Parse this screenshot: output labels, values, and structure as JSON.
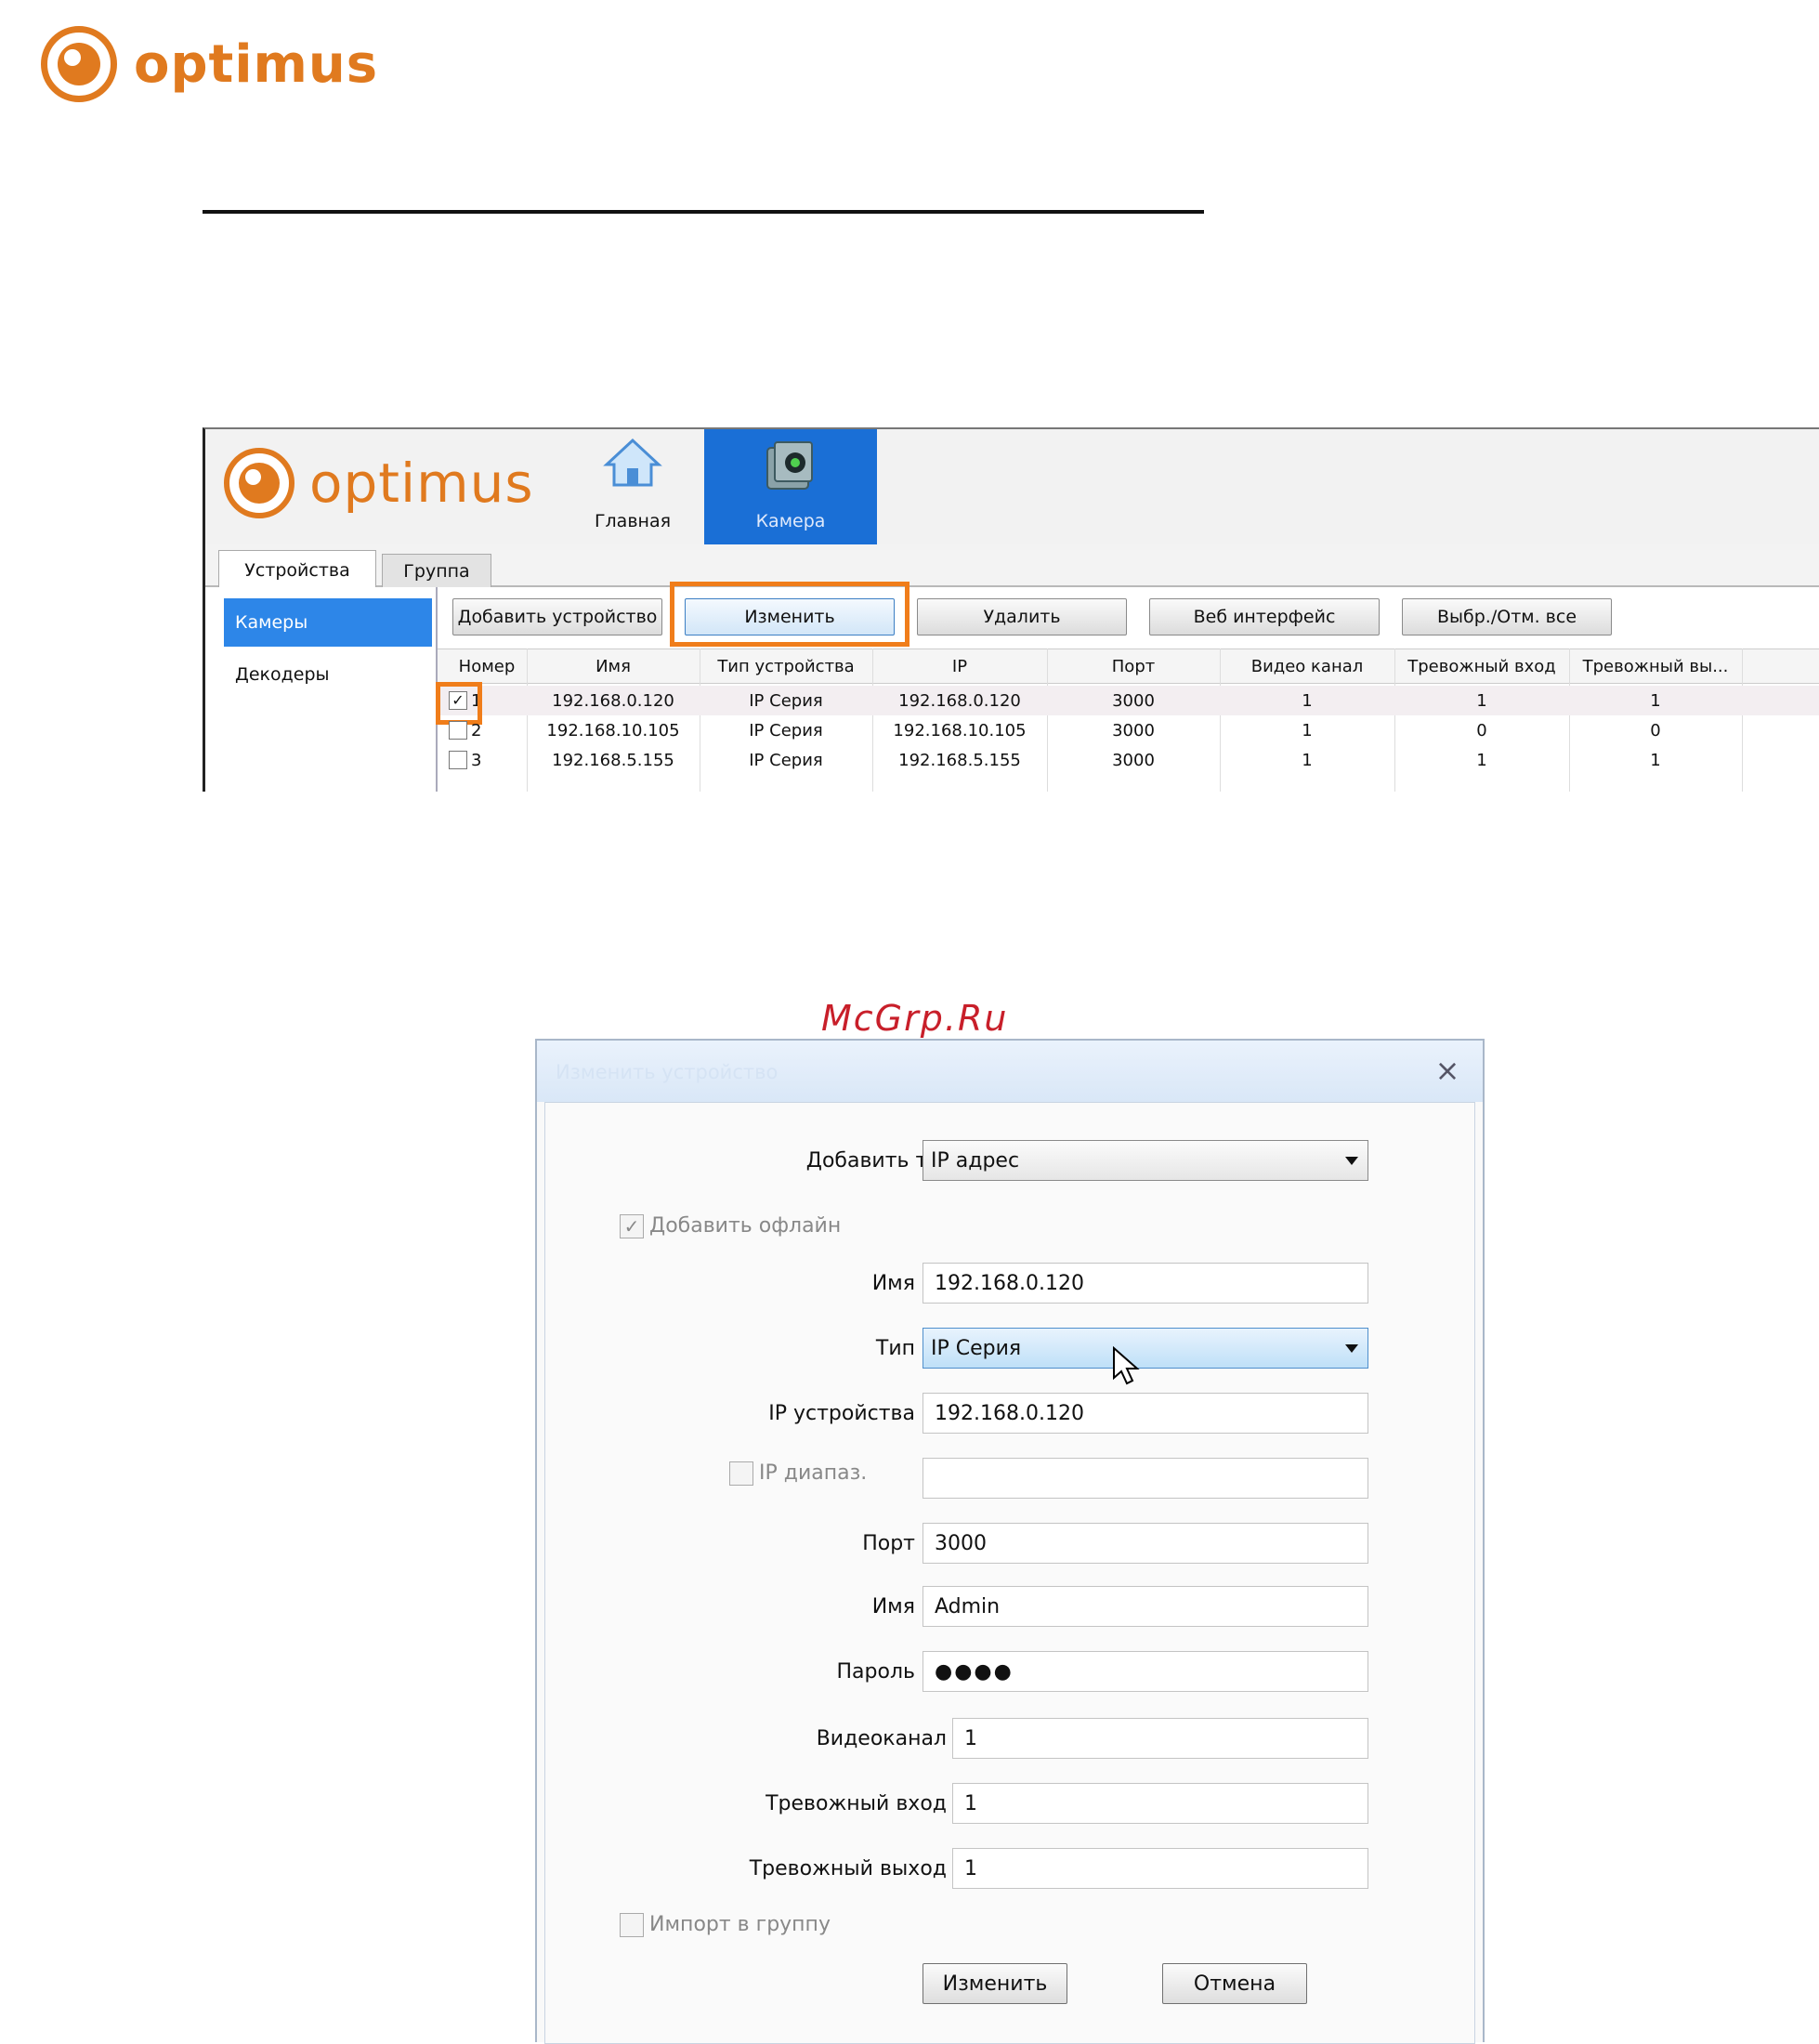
{
  "brand": {
    "name": "optimus",
    "color": "#e07a1f"
  },
  "app": {
    "nav": [
      {
        "label": "Главная",
        "icon": "home-icon"
      },
      {
        "label": "Камера",
        "icon": "camera-icon"
      }
    ],
    "tabs": [
      "Устройства",
      "Группа"
    ],
    "sidebar": [
      "Камеры",
      "Декодеры"
    ],
    "toolbar": {
      "add": "Добавить устройство",
      "edit": "Изменить",
      "delete": "Удалить",
      "web": "Веб интерфейс",
      "select_all": "Выбр./Отм. все"
    },
    "columns": [
      "Номер",
      "Имя",
      "Тип устройства",
      "IP",
      "Порт",
      "Видео канал",
      "Тревожный вход",
      "Тревожный вы..."
    ],
    "rows": [
      {
        "checked": true,
        "num": "1",
        "name": "192.168.0.120",
        "type": "IP Серия",
        "ip": "192.168.0.120",
        "port": "3000",
        "video": "1",
        "alarm_in": "1",
        "alarm_out": "1"
      },
      {
        "checked": false,
        "num": "2",
        "name": "192.168.10.105",
        "type": "IP Серия",
        "ip": "192.168.10.105",
        "port": "3000",
        "video": "1",
        "alarm_in": "0",
        "alarm_out": "0"
      },
      {
        "checked": false,
        "num": "3",
        "name": "192.168.5.155",
        "type": "IP Серия",
        "ip": "192.168.5.155",
        "port": "3000",
        "video": "1",
        "alarm_in": "1",
        "alarm_out": "1"
      }
    ],
    "highlight_color": "#f07d1a",
    "accent_color": "#1a6fd6"
  },
  "watermark": "McGrp.Ru",
  "dialog": {
    "title": "Изменить устройство",
    "add_type_label": "Добавить тип",
    "add_type_value": "IP адрес",
    "add_offline_label": "Добавить офлайн",
    "name_label": "Имя",
    "name_value": "192.168.0.120",
    "type_label": "Тип",
    "type_value": "IP Серия",
    "device_ip_label": "IP устройства",
    "device_ip_value": "192.168.0.120",
    "ip_range_label": "IP диапаз.",
    "ip_range_value": "",
    "port_label": "Порт",
    "port_value": "3000",
    "user_label": "Имя",
    "user_value": "Admin",
    "password_label": "Пароль",
    "password_value": "●●●●",
    "video_label": "Видеоканал",
    "video_value": "1",
    "alarm_in_label": "Тревожный вход",
    "alarm_in_value": "1",
    "alarm_out_label": "Тревожный выход",
    "alarm_out_value": "1",
    "import_group_label": "Импорт в группу",
    "ok_button": "Изменить",
    "cancel_button": "Отмена"
  }
}
